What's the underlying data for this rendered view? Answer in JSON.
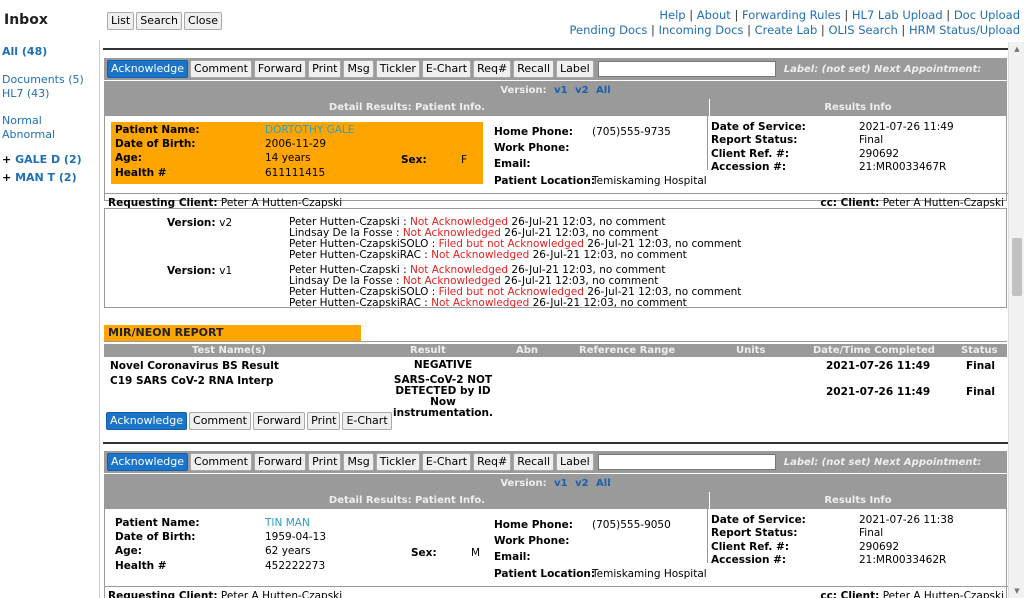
{
  "header": {
    "title": "Inbox",
    "buttons": [
      "List",
      "Search",
      "Close"
    ],
    "links_row1": [
      "Help",
      "About",
      "Forwarding Rules",
      "HL7 Lab Upload",
      "Doc Upload"
    ],
    "links_row2": [
      "Pending Docs",
      "Incoming Docs",
      "Create Lab",
      "OLIS Search",
      "HRM Status/Upload"
    ]
  },
  "sidebar": {
    "all": "All (48)",
    "documents": "Documents (5)",
    "hl7": "HL7 (43)",
    "normal": "Normal",
    "abnormal": "Abnormal",
    "patient1": "GALE D (2)",
    "patient2": "MAN T (2)"
  },
  "toolbar": {
    "acknowledge": "Acknowledge",
    "comment": "Comment",
    "forward": "Forward",
    "print": "Print",
    "msg": "Msg",
    "tickler": "Tickler",
    "echart": "E-Chart",
    "req": "Req#",
    "recall": "Recall",
    "label": "Label",
    "label_note": "Label: (not set) Next Appointment:"
  },
  "version_row": {
    "label": "Version:",
    "v1": "v1",
    "v2": "v2",
    "all": "All"
  },
  "headers": {
    "detail": "Detail Results: Patient Info.",
    "results_info": "Results Info"
  },
  "labels": {
    "patient_name": "Patient Name:",
    "dob": "Date of Birth:",
    "age": "Age:",
    "health": "Health #",
    "sex": "Sex:",
    "home_phone": "Home Phone:",
    "work_phone": "Work Phone:",
    "email": "Email:",
    "patient_location": "Patient Location:",
    "date_of_service": "Date of Service:",
    "report_status": "Report Status:",
    "client_ref": "Client Ref. #:",
    "accession": "Accession #:",
    "requesting_client": "Requesting Client:",
    "cc_client": "cc: Client:"
  },
  "lab1": {
    "patient_name": "DORTOTHY GALE",
    "dob": "2006-11-29",
    "age": "14 years",
    "sex": "F",
    "health": "611111415",
    "home_phone": "(705)555-9735",
    "patient_location": "Temiskaming Hospital",
    "date_of_service": "2021-07-26 11:49",
    "report_status": "Final",
    "client_ref": "290692",
    "accession": "21:MR0033467R",
    "requesting_client": "Peter A Hutten-Czapski",
    "cc_client": "Peter A Hutten-Czapski"
  },
  "history": {
    "v2_label": "Version:",
    "v2_num": "v2",
    "v1_label": "Version:",
    "v1_num": "v1",
    "v2_entries": [
      {
        "name": "Peter Hutten-Czapski :",
        "status": "Not Acknowledged",
        "rest": "26-Jul-21 12:03, no comment"
      },
      {
        "name": "Lindsay De la Fosse :",
        "status": "Not Acknowledged",
        "rest": "26-Jul-21 12:03, no comment"
      },
      {
        "name": "Peter Hutten-CzapskiSOLO :",
        "status": "Filed but not Acknowledged",
        "rest": "26-Jul-21 12:03, no comment"
      },
      {
        "name": "Peter Hutten-CzapskiRAC :",
        "status": "Not Acknowledged",
        "rest": "26-Jul-21 12:03, no comment"
      }
    ],
    "v1_entries": [
      {
        "name": "Peter Hutten-Czapski :",
        "status": "Not Acknowledged",
        "rest": "26-Jul-21 12:03, no comment"
      },
      {
        "name": "Lindsay De la Fosse :",
        "status": "Not Acknowledged",
        "rest": "26-Jul-21 12:03, no comment"
      },
      {
        "name": "Peter Hutten-CzapskiSOLO :",
        "status": "Filed but not Acknowledged",
        "rest": "26-Jul-21 12:03, no comment"
      },
      {
        "name": "Peter Hutten-CzapskiRAC :",
        "status": "Not Acknowledged",
        "rest": "26-Jul-21 12:03, no comment"
      }
    ]
  },
  "report": {
    "title": "MIR/NEON REPORT",
    "columns": [
      "Test Name(s)",
      "Result",
      "Abn",
      "Reference Range",
      "Units",
      "Date/Time Completed",
      "Status"
    ],
    "rows": [
      {
        "name": "Novel Coronavirus BS Result",
        "result": "NEGATIVE",
        "date": "2021-07-26 11:49",
        "status": "Final"
      },
      {
        "name": "C19 SARS CoV-2 RNA Interp",
        "result": "SARS-CoV-2 NOT DETECTED by ID Now instrumentation.",
        "date": "2021-07-26 11:49",
        "status": "Final"
      }
    ]
  },
  "lab2": {
    "patient_name": "TIN MAN",
    "dob": "1959-04-13",
    "age": "62 years",
    "sex": "M",
    "health": "452222273",
    "home_phone": "(705)555-9050",
    "patient_location": "Temiskaming Hospital",
    "date_of_service": "2021-07-26 11:38",
    "report_status": "Final",
    "client_ref": "290692",
    "accession": "21:MR0033462R",
    "requesting_client": "Peter A Hutten-Czapski",
    "cc_client": "Peter A Hutten-Czapski"
  },
  "colors": {
    "accent": "#1a74c9",
    "highlight": "#ffa500",
    "header_gray": "#9a9a9a",
    "alert_red": "#e02020",
    "link": "#1f6fb5"
  }
}
